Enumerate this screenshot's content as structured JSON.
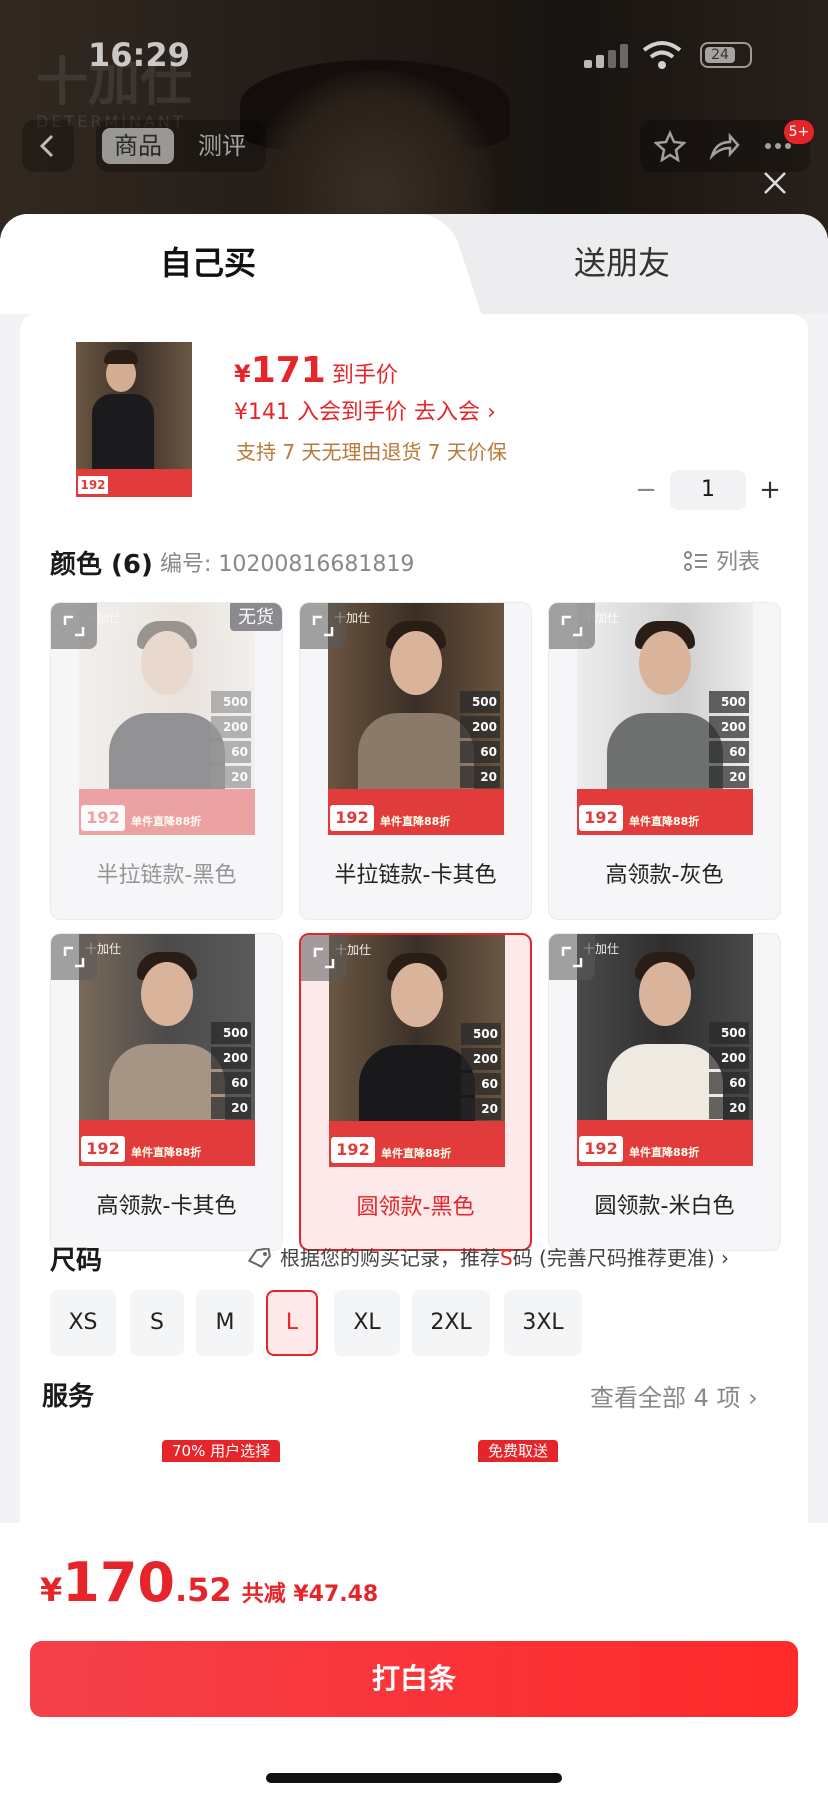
{
  "status": {
    "time": "16:29",
    "battery": "24"
  },
  "nav": {
    "tab_product": "商品",
    "tab_review": "测评",
    "badge": "5+"
  },
  "background": {
    "logo": "十加仕",
    "brand": "DETERMINANT"
  },
  "sheet": {
    "tab_self": "自己买",
    "tab_gift": "送朋友"
  },
  "product": {
    "yen": "¥",
    "price": "171",
    "price_suffix": "到手价",
    "member_line": "¥141 入会到手价 去入会 ›",
    "guarantee": "支持 7 天无理由退货   7 天价保",
    "qty_minus": "−",
    "qty_value": "1",
    "qty_plus": "+",
    "thumb_price": "192"
  },
  "color": {
    "title": "颜色 (6)",
    "code_label": "编号: 10200816681819",
    "list_toggle": "列表",
    "oos_tag": "无货",
    "items": [
      {
        "label": "半拉链款-黑色",
        "promo_price": "192",
        "promo_text": "单件直降88折",
        "stack": [
          "500",
          "200",
          "60",
          "20"
        ]
      },
      {
        "label": "半拉链款-卡其色",
        "promo_price": "192",
        "promo_text": "单件直降88折",
        "stack": [
          "500",
          "200",
          "60",
          "20"
        ]
      },
      {
        "label": "高领款-灰色",
        "promo_price": "192",
        "promo_text": "单件直降88折",
        "stack": [
          "500",
          "200",
          "60",
          "20"
        ]
      },
      {
        "label": "高领款-卡其色",
        "promo_price": "192",
        "promo_text": "单件直降88折",
        "stack": [
          "500",
          "200",
          "60",
          "20"
        ]
      },
      {
        "label": "圆领款-黑色",
        "promo_price": "192",
        "promo_text": "单件直降88折",
        "stack": [
          "500",
          "200",
          "60",
          "20"
        ]
      },
      {
        "label": "圆领款-米白色",
        "promo_price": "192",
        "promo_text": "单件直降88折",
        "stack": [
          "500",
          "200",
          "60",
          "20"
        ]
      }
    ],
    "selected_index": 4,
    "out_of_stock_index": 0
  },
  "size": {
    "title": "尺码",
    "hint_pre": "根据您的购买记录，推荐",
    "hint_size": "S",
    "hint_post": "码 (完善尺码推荐更准) ›",
    "options": [
      "XS",
      "S",
      "M",
      "L",
      "XL",
      "2XL",
      "3XL"
    ],
    "selected": "L"
  },
  "service": {
    "title": "服务",
    "more": "查看全部 4 项  ›",
    "tag1": "70% 用户选择",
    "tag2": "免费取送"
  },
  "bottom": {
    "yen": "¥",
    "total_int": "170",
    "total_dec": ".52",
    "saving": "共减 ¥47.48",
    "pay_button": "打白条"
  },
  "colors": {
    "accent": "#e6252a",
    "guarantee": "#b77a3a"
  }
}
